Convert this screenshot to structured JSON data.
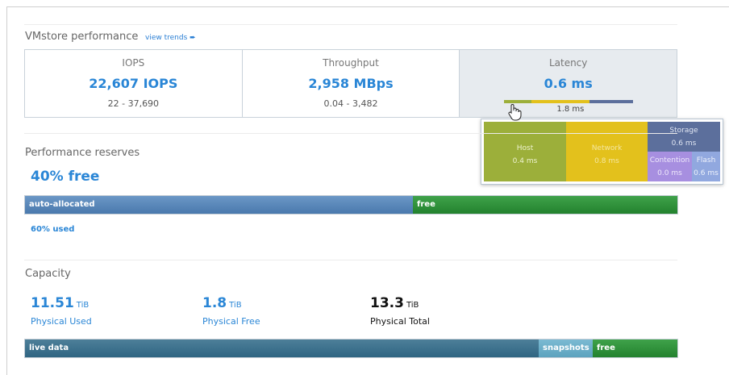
{
  "performance": {
    "title": "VMstore performance",
    "view_trends": "view trends",
    "metrics": [
      {
        "label": "IOPS",
        "value": "22,607 IOPS",
        "range": "22 - 37,690"
      },
      {
        "label": "Throughput",
        "value": "2,958 MBps",
        "range": "0.04 - 3,482"
      },
      {
        "label": "Latency",
        "value": "0.6 ms",
        "sub": "1.8 ms"
      }
    ],
    "latency_breakdown": {
      "host": {
        "label": "Host",
        "value": "0.4 ms",
        "color": "#9caf3a"
      },
      "network": {
        "label": "Network",
        "value": "0.8 ms",
        "color": "#e3c11c"
      },
      "storage": {
        "label": "Storage",
        "value": "0.6 ms",
        "color": "#5c6f9c"
      },
      "contention": {
        "label": "Contention",
        "value": "0.0 ms",
        "color": "#a78fe0"
      },
      "flash": {
        "label": "Flash",
        "value": "0.6 ms",
        "color": "#91a8df"
      }
    }
  },
  "reserves": {
    "title": "Performance reserves",
    "free_text": "40% free",
    "bar": {
      "auto_allocated": "auto-allocated",
      "free": "free"
    },
    "used_text": "60% used",
    "used_fraction": 0.6
  },
  "capacity": {
    "title": "Capacity",
    "items": [
      {
        "value": "11.51",
        "unit": "TiB",
        "label": "Physical Used"
      },
      {
        "value": "1.8",
        "unit": "TiB",
        "label": "Physical Free"
      },
      {
        "value": "13.3",
        "unit": "TiB",
        "label": "Physical Total"
      }
    ],
    "bar": {
      "live": "live data",
      "snapshots": "snapshots",
      "free": "free"
    }
  },
  "colors": {
    "accent": "#2a86d6",
    "free_green": "#23822e",
    "auto_blue": "#4a79ad",
    "live_teal": "#2f6582"
  }
}
